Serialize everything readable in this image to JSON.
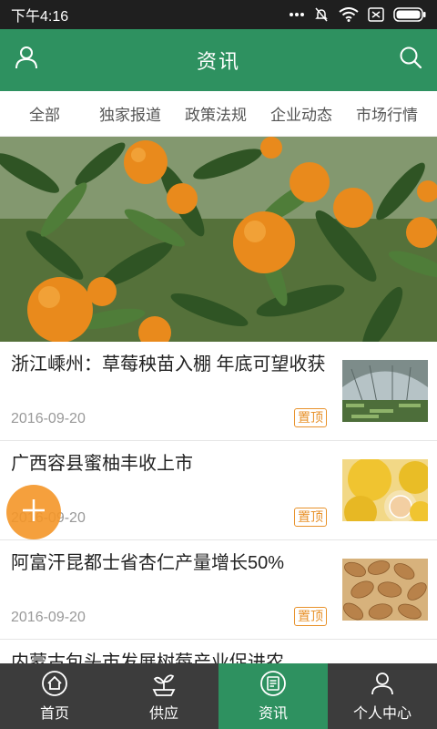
{
  "status_bar": {
    "time": "下午4:16",
    "icons": [
      "dots-icon",
      "mute-icon",
      "wifi-icon",
      "sim-icon",
      "battery-icon"
    ]
  },
  "app_bar": {
    "title": "资讯",
    "left_icon": "user-icon",
    "right_icon": "search-icon"
  },
  "tabs": [
    "全部",
    "独家报道",
    "政策法规",
    "企业动态",
    "市场行情"
  ],
  "banner": {
    "alt": "orange-tree-photo"
  },
  "news": [
    {
      "title": "浙江嵊州：草莓秧苗入棚 年底可望收获",
      "date": "2016-09-20",
      "pin": "置顶",
      "thumb": "greenhouse-photo"
    },
    {
      "title": "广西容县蜜柚丰收上市",
      "date": "2016-09-20",
      "pin": "置顶",
      "thumb": "pomelo-photo"
    },
    {
      "title": "阿富汗昆都士省杏仁产量增长50%",
      "date": "2016-09-20",
      "pin": "置顶",
      "thumb": "almond-photo"
    },
    {
      "title": "内蒙古包头市发展树莓产业促进农",
      "date": "",
      "pin": "",
      "thumb": ""
    }
  ],
  "fab": {
    "icon": "plus-icon"
  },
  "bottom_nav": [
    {
      "label": "首页",
      "icon": "home-icon"
    },
    {
      "label": "供应",
      "icon": "supply-icon"
    },
    {
      "label": "资讯",
      "icon": "news-icon"
    },
    {
      "label": "个人中心",
      "icon": "profile-icon"
    }
  ],
  "colors": {
    "primary": "#2e9160",
    "pin": "#e8922b",
    "fab": "#f49628",
    "nav_bg": "#3c3c3c",
    "status_bg": "#1f1f1f"
  }
}
